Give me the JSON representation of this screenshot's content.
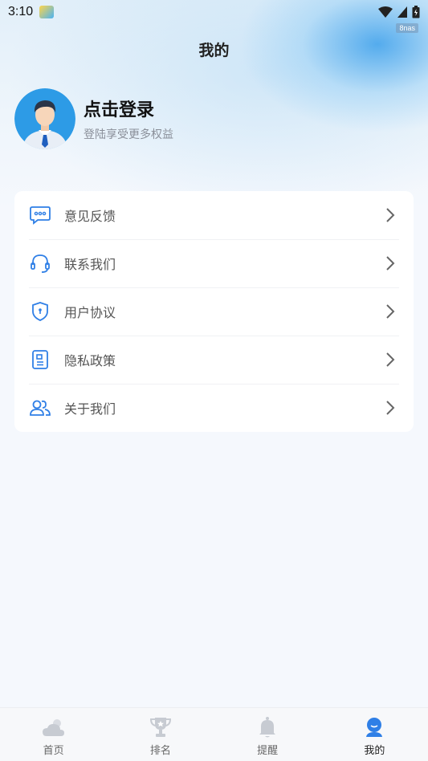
{
  "status_bar": {
    "time": "3:10",
    "badge": "8nas"
  },
  "header": {
    "title": "我的"
  },
  "profile": {
    "name": "点击登录",
    "subtitle": "登陆享受更多权益"
  },
  "menu": {
    "items": [
      {
        "label": "意见反馈",
        "icon": "chat-bubble-icon"
      },
      {
        "label": "联系我们",
        "icon": "headset-icon"
      },
      {
        "label": "用户协议",
        "icon": "shield-icon"
      },
      {
        "label": "隐私政策",
        "icon": "document-icon"
      },
      {
        "label": "关于我们",
        "icon": "people-icon"
      }
    ]
  },
  "tabbar": {
    "tabs": [
      {
        "label": "首页",
        "icon": "weather-icon"
      },
      {
        "label": "排名",
        "icon": "trophy-icon"
      },
      {
        "label": "提醒",
        "icon": "bell-icon"
      },
      {
        "label": "我的",
        "icon": "user-icon",
        "active": true
      }
    ]
  },
  "colors": {
    "accent": "#2f7fe6",
    "inactive_icon": "#c7cbd2",
    "background": "#f5f8fd"
  }
}
